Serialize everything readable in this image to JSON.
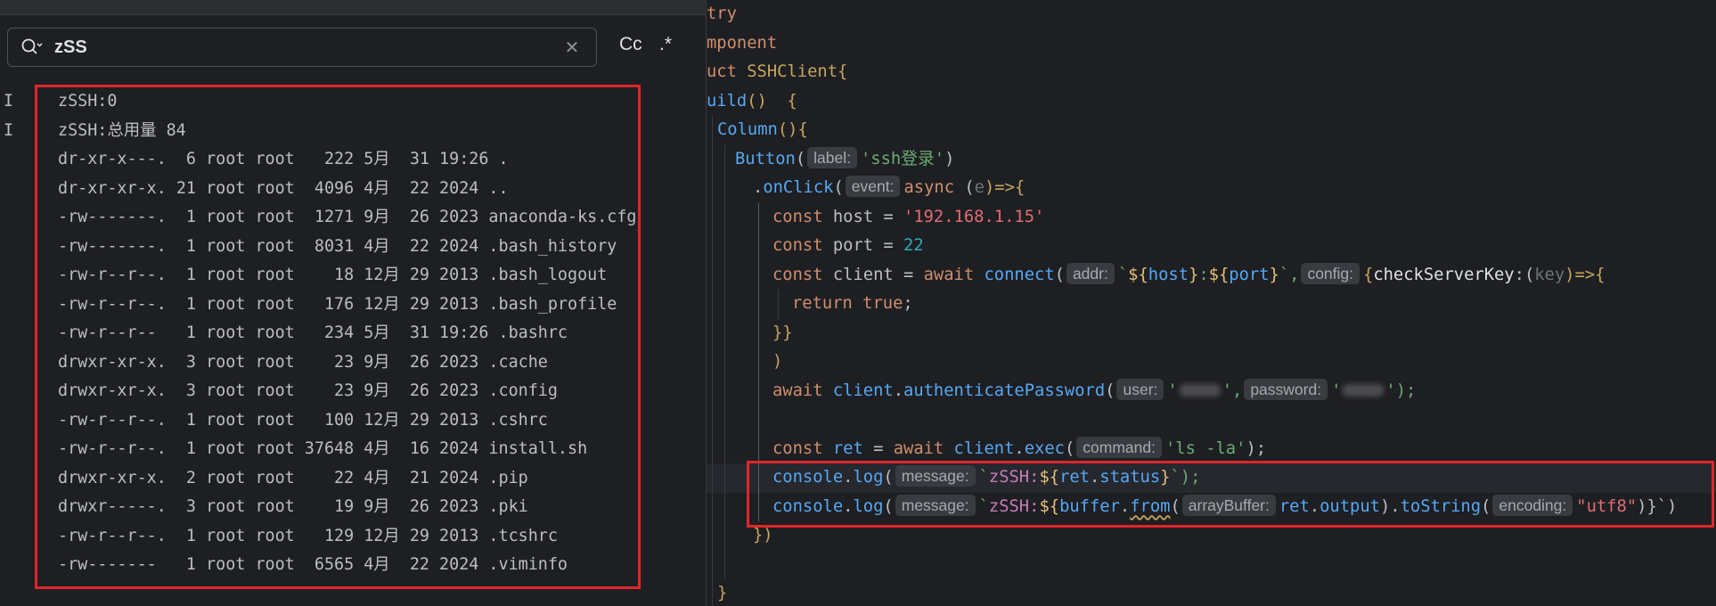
{
  "search": {
    "value": "zSS",
    "clear_icon": "close-icon",
    "case_label": "Cc",
    "regex_label": ".*"
  },
  "log": {
    "lines": [
      {
        "level": "I",
        "text": "zSSH:0"
      },
      {
        "level": "I",
        "text": "zSSH:总用量 84"
      },
      {
        "level": "",
        "text": "dr-xr-x---.  6 root root   222 5月  31 19:26 ."
      },
      {
        "level": "",
        "text": "dr-xr-xr-x. 21 root root  4096 4月  22 2024 .."
      },
      {
        "level": "",
        "text": "-rw-------.  1 root root  1271 9月  26 2023 anaconda-ks.cfg"
      },
      {
        "level": "",
        "text": "-rw-------.  1 root root  8031 4月  22 2024 .bash_history"
      },
      {
        "level": "",
        "text": "-rw-r--r--.  1 root root    18 12月 29 2013 .bash_logout"
      },
      {
        "level": "",
        "text": "-rw-r--r--.  1 root root   176 12月 29 2013 .bash_profile"
      },
      {
        "level": "",
        "text": "-rw-r--r--   1 root root   234 5月  31 19:26 .bashrc"
      },
      {
        "level": "",
        "text": "drwxr-xr-x.  3 root root    23 9月  26 2023 .cache"
      },
      {
        "level": "",
        "text": "drwxr-xr-x.  3 root root    23 9月  26 2023 .config"
      },
      {
        "level": "",
        "text": "-rw-r--r--.  1 root root   100 12月 29 2013 .cshrc"
      },
      {
        "level": "",
        "text": "-rw-r--r--.  1 root root 37648 4月  16 2024 install.sh"
      },
      {
        "level": "",
        "text": "drwxr-xr-x.  2 root root    22 4月  21 2024 .pip"
      },
      {
        "level": "",
        "text": "drwxr-----.  3 root root    19 9月  26 2023 .pki"
      },
      {
        "level": "",
        "text": "-rw-r--r--.  1 root root   129 12月 29 2013 .tcshrc"
      },
      {
        "level": "",
        "text": "-rw-------   1 root root  6565 4月  22 2024 .viminfo"
      }
    ]
  },
  "code": {
    "l1": "try",
    "l2": "mponent",
    "l3_kw": "uct",
    "l3_cls": "SSHClient",
    "l3_brace": "{",
    "l4_fn": "uild",
    "l4_rest": "()  {",
    "l5_fn": "Column",
    "l5_rest": "(){",
    "l6_fn": "Button",
    "l6_open": "(",
    "l6_hint": "label:",
    "l6_str": "'ssh登录'",
    "l6_close": ")",
    "l7_dot": ".",
    "l7_fn": "onClick",
    "l7_open": "(",
    "l7_hint": "event:",
    "l7_async": "async",
    "l7_param_open": " (",
    "l7_param": "e",
    "l7_arrow": ")=>{",
    "l8_kw": "const",
    "l8_var": " host = ",
    "l8_str": "'192.168.1.15'",
    "l9_kw": "const",
    "l9_var": " port = ",
    "l9_num": "22",
    "l10_kw": "const",
    "l10_var": " client = ",
    "l10_await": "await",
    "l10_fn": " connect",
    "l10_open": "(",
    "l10_hint1": "addr:",
    "l10_tick": "`",
    "l10_d1": "${",
    "l10_v1": "host",
    "l10_c1": "}",
    "l10_colon": ":",
    "l10_d2": "${",
    "l10_v2": "port",
    "l10_c2": "}",
    "l10_tick2": "`,",
    "l10_hint2": "config:",
    "l10_obj": "{",
    "l10_key": "checkServerKey",
    "l10_colon2": ":",
    "l10_popen": "(",
    "l10_param": "key",
    "l10_arrow": ")=>{",
    "l11_kw": "return",
    "l11_true": " true",
    "l11_semi": ";",
    "l12": "}}",
    "l13": ")",
    "l14_await": "await",
    "l14_obj": " client",
    "l14_dot": ".",
    "l14_fn": "authenticatePassword",
    "l14_open": "(",
    "l14_hint1": "user:",
    "l14_q1": "'",
    "l14_comma": "',",
    "l14_hint2": "password:",
    "l14_q2": "'",
    "l14_close": "');",
    "l16_kw": "const",
    "l16_ret": " ret",
    "l16_eq": " = ",
    "l16_await": "await",
    "l16_obj": " client",
    "l16_dot": ".",
    "l16_fn": "exec",
    "l16_open": "(",
    "l16_hint": "command:",
    "l16_str": "'ls -la'",
    "l16_close": ");",
    "l17_obj": "console",
    "l17_dot": ".",
    "l17_fn": "log",
    "l17_open": "(",
    "l17_hint": "message:",
    "l17_tick": "`",
    "l17_text": "zSSH:",
    "l17_d": "${",
    "l17_v": "ret",
    "l17_dot2": ".",
    "l17_p": "status",
    "l17_c": "}",
    "l17_close": "`);",
    "l18_obj": "console",
    "l18_dot": ".",
    "l18_fn": "log",
    "l18_open": "(",
    "l18_hint": "message:",
    "l18_tick": "`",
    "l18_text": "zSSH:",
    "l18_d": "${",
    "l18_buf": "buffer",
    "l18_dot2": ".",
    "l18_from": "from",
    "l18_open2": "(",
    "l18_hint2": "arrayBuffer:",
    "l18_ret": "ret",
    "l18_dot3": ".",
    "l18_out": "output",
    "l18_close2": ").",
    "l18_ts": "toString",
    "l18_open3": "(",
    "l18_hint3": "encoding:",
    "l18_str": "\"utf8\"",
    "l18_end": ")}`)",
    "l19": "})",
    "l21": "}"
  },
  "colors": {
    "background": "#1e1f22",
    "highlight_border": "#e0262a",
    "keyword": "#cf8e6d",
    "function": "#56a8f5",
    "string": "#6aab73",
    "number": "#2aacb8",
    "property": "#c77dbb"
  }
}
